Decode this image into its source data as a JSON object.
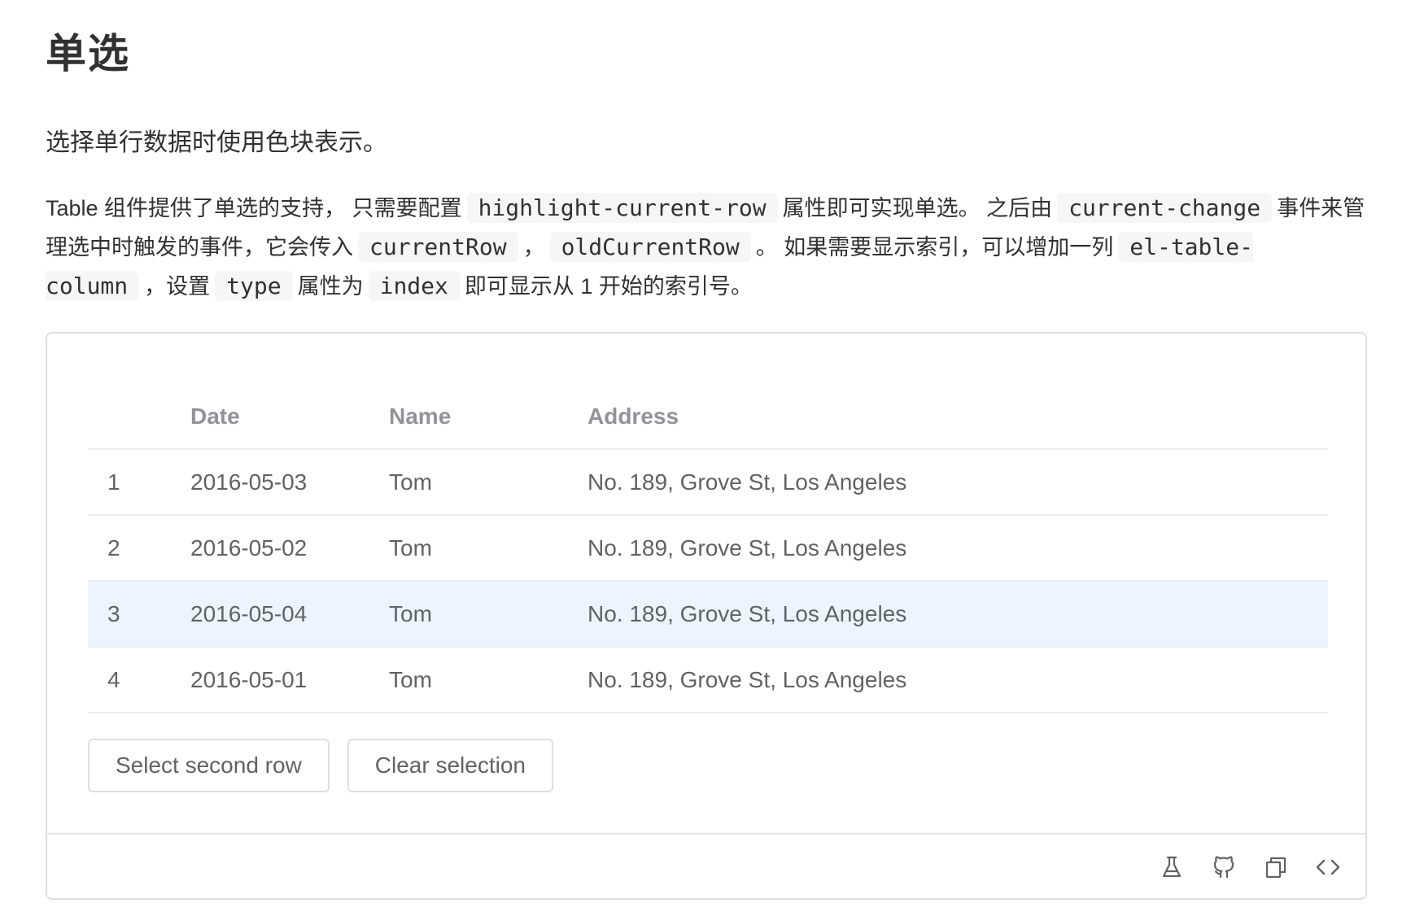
{
  "page": {
    "title": "单选",
    "lead": "选择单行数据时使用色块表示。",
    "description": {
      "t1": "Table 组件提供了单选的支持， 只需要配置",
      "c1": "highlight-current-row",
      "t2": "属性即可实现单选。 之后由",
      "c2": "current-change",
      "t3": "事件来管理选中时触发的事件，它会传入",
      "c3": "currentRow",
      "t4": "，",
      "c4": "oldCurrentRow",
      "t5": "。 如果需要显示索引，可以增加一列",
      "c5": "el-table-column",
      "t6": "，设置",
      "c6": "type",
      "t7": "属性为",
      "c7": "index",
      "t8": "即可显示从 1 开始的索引号。"
    }
  },
  "table": {
    "columns": {
      "index": "",
      "date": "Date",
      "name": "Name",
      "address": "Address"
    },
    "rows": [
      {
        "index": "1",
        "date": "2016-05-03",
        "name": "Tom",
        "address": "No. 189, Grove St, Los Angeles",
        "current": false
      },
      {
        "index": "2",
        "date": "2016-05-02",
        "name": "Tom",
        "address": "No. 189, Grove St, Los Angeles",
        "current": false
      },
      {
        "index": "3",
        "date": "2016-05-04",
        "name": "Tom",
        "address": "No. 189, Grove St, Los Angeles",
        "current": true
      },
      {
        "index": "4",
        "date": "2016-05-01",
        "name": "Tom",
        "address": "No. 189, Grove St, Los Angeles",
        "current": false
      }
    ],
    "highlight_color": "#ecf5ff"
  },
  "buttons": {
    "select_second": "Select second row",
    "clear_selection": "Clear selection"
  },
  "footer_icons": [
    "flask-icon",
    "github-icon",
    "copy-icon",
    "code-icon"
  ]
}
